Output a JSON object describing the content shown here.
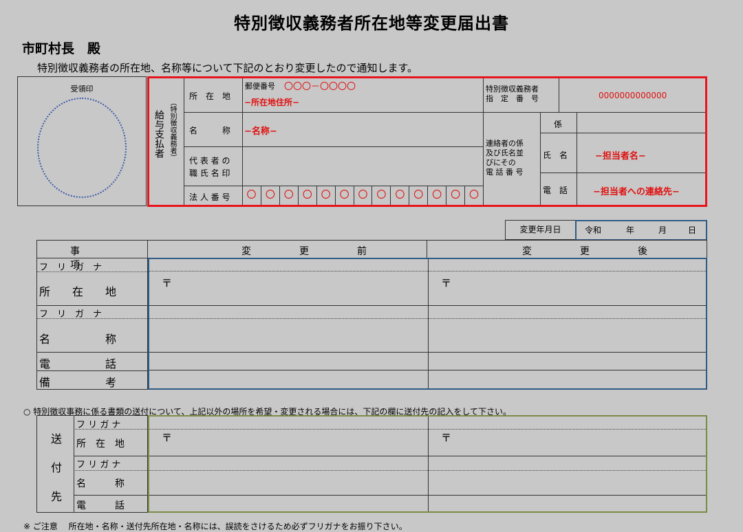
{
  "title": "特別徴収義務者所在地等変更届出書",
  "addressee": "市町村長　殿",
  "intro": "特別徴収義務者の所在地、名称等について下記のとおり変更したので通知します。",
  "stamp": {
    "label": "受領印"
  },
  "payer": {
    "side_label": "給与支払者",
    "side_sub": "（特別徴収義務者）",
    "address_label": "所　在　地",
    "postal_label": "郵便番号",
    "postal_value": "〇〇〇－〇〇〇〇",
    "address_value": "−所在地住所−",
    "name_label": "名　　　称",
    "name_value": "−名称−",
    "rep_label_1": "代 表 者 の",
    "rep_label_2": "職 氏 名 印",
    "corp_label": "法 人 番 号",
    "corp_digits": [
      "〇",
      "〇",
      "〇",
      "〇",
      "〇",
      "〇",
      "〇",
      "〇",
      "〇",
      "〇",
      "〇",
      "〇",
      "〇"
    ],
    "designated_label_1": "特別徴収義務者",
    "designated_label_2": "指　定　番　号",
    "designated_value": "0000000000000",
    "contact_label_1": "連絡者の係",
    "contact_label_2": "及び氏名並",
    "contact_label_3": "びにその",
    "contact_label_4": "電 話 番 号",
    "section_label": "係",
    "person_label": "氏　名",
    "person_value": "−担当者名−",
    "phone_label": "電　話",
    "phone_value": "−担当者への連絡先−"
  },
  "change_date": {
    "label": "変更年月日",
    "era": "令和",
    "year": "年",
    "month": "月",
    "day": "日"
  },
  "main": {
    "col_item": "事　項",
    "col_before": "変　更　前",
    "col_after": "変　更　後",
    "furigana": "フ　リ　ガ　ナ",
    "address": "所　　在　　地",
    "name": "名　　　　　称",
    "phone": "電　　　　　話",
    "remarks": "備　　　　　考",
    "postal_mark": "〒"
  },
  "notice": "○ 特別徴収事務に係る書類の送付について、上記以外の場所を希望・変更される場合には、下記の欄に送付先の記入をして下さい。",
  "send": {
    "side_1": "送",
    "side_2": "付",
    "side_3": "先",
    "furigana": "フ リ ガ ナ",
    "address": "所　在　地",
    "name": "名　　　称",
    "phone": "電　　　話",
    "postal_mark": "〒"
  },
  "footer": "※ ご注意　 所在地・名称・送付先所在地・名称には、誤読をさけるため必ずフリガナをお振り下さい。"
}
